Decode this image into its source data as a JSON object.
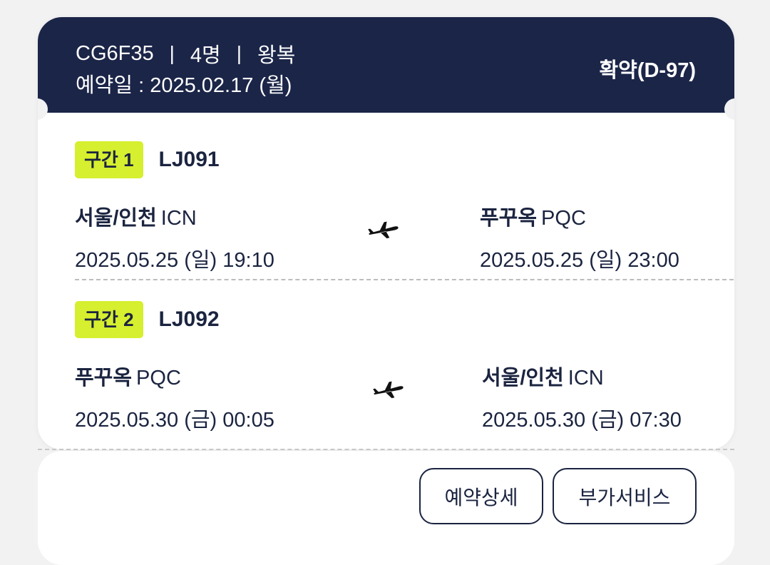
{
  "header": {
    "booking_code": "CG6F35",
    "separator": "|",
    "passengers": "4명",
    "trip_type": "왕복",
    "booking_date_label": "예약일 : ",
    "booking_date": "2025.02.17 (월)",
    "status": "확약(D-97)"
  },
  "segments": [
    {
      "badge": "구간 1",
      "flight": "LJ091",
      "departure": {
        "city": "서울/인천",
        "code": "ICN",
        "datetime": "2025.05.25 (일) 19:10"
      },
      "arrival": {
        "city": "푸꾸옥",
        "code": "PQC",
        "datetime": "2025.05.25 (일) 23:00"
      },
      "icon": "airplane-icon"
    },
    {
      "badge": "구간 2",
      "flight": "LJ092",
      "departure": {
        "city": "푸꾸옥",
        "code": "PQC",
        "datetime": "2025.05.30 (금) 00:05"
      },
      "arrival": {
        "city": "서울/인천",
        "code": "ICN",
        "datetime": "2025.05.30 (금) 07:30"
      },
      "icon": "airplane-icon"
    }
  ],
  "buttons": {
    "detail": "예약상세",
    "extra": "부가서비스"
  },
  "colors": {
    "header_bg": "#1b2548",
    "badge_bg": "#d6ef2f",
    "text_dark": "#1b2440"
  }
}
